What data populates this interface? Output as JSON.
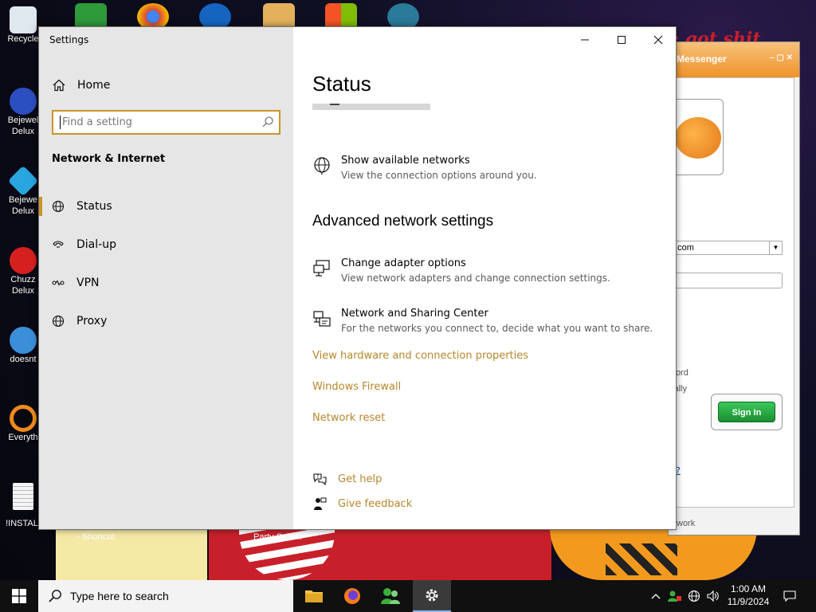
{
  "desktop": {
    "icons": [
      {
        "label": "Recycle",
        "color": "#dfe7ef"
      },
      {
        "label": "Bejewel Delux",
        "color": "#2b4fc0"
      },
      {
        "label": "Bejewe Delux",
        "color": "#29a6e0"
      },
      {
        "label": "Chuzz Delux",
        "color": "#d62020"
      },
      {
        "label": "doesnt",
        "color": "#3a8fd8"
      },
      {
        "label": "Everyth",
        "color": "#f08a1a"
      },
      {
        "label": "!INSTALI",
        "color": "#f5f5f5"
      }
    ],
    "wallpaper_text": "e got shit",
    "captions": {
      "shortcut": "- Shortcut",
      "party": "Party Scre..."
    }
  },
  "messenger": {
    "title": "Messenger",
    "account": "b.com",
    "remember_password": "word",
    "sign_in_automatically": "cally",
    "sign_in_label": "Sign In",
    "help_link": "?",
    "status": "work"
  },
  "settings": {
    "window_title": "Settings",
    "home_label": "Home",
    "search_placeholder": "Find a setting",
    "section_title": "Network & Internet",
    "nav": [
      {
        "label": "Status",
        "icon": "globe-icon",
        "active": true
      },
      {
        "label": "Dial-up",
        "icon": "phone-icon",
        "active": false
      },
      {
        "label": "VPN",
        "icon": "vpn-icon",
        "active": false
      },
      {
        "label": "Proxy",
        "icon": "globe-icon",
        "active": false
      }
    ],
    "page_title": "Status",
    "loading_progress": 0.3,
    "show_networks": {
      "title": "Show available networks",
      "desc": "View the connection options around you."
    },
    "advanced_heading": "Advanced network settings",
    "adapter": {
      "title": "Change adapter options",
      "desc": "View network adapters and change connection settings."
    },
    "sharing": {
      "title": "Network and Sharing Center",
      "desc": "For the networks you connect to, decide what you want to share."
    },
    "links": {
      "hardware": "View hardware and connection properties",
      "firewall": "Windows Firewall",
      "reset": "Network reset"
    },
    "help": {
      "get_help": "Get help",
      "give_feedback": "Give feedback"
    },
    "accent_color": "#c8942a"
  },
  "taskbar": {
    "search_placeholder": "Type here to search",
    "time": "1:00 AM",
    "date": "11/9/2024"
  }
}
